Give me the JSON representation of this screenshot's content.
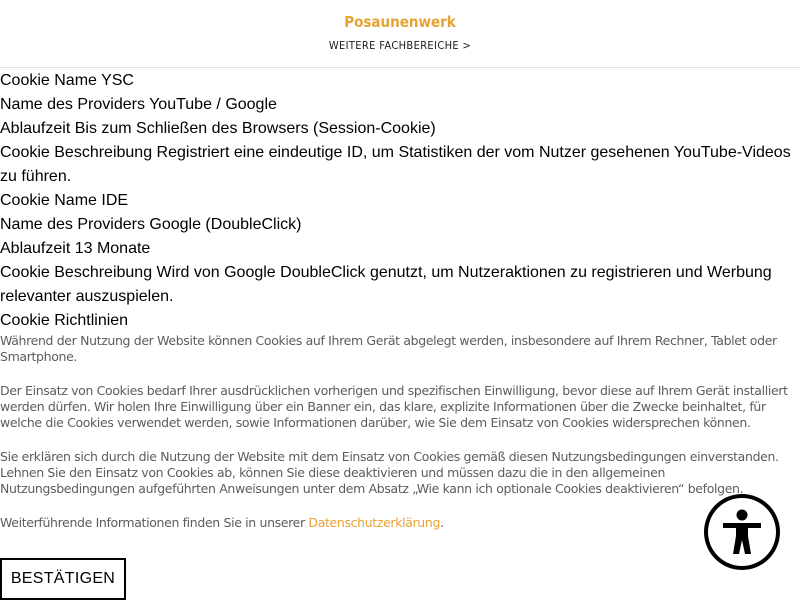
{
  "header": {
    "brand": "Posaunenwerk",
    "subnav_label": "WEITERE FACHBEREICHE >"
  },
  "cookie": {
    "rows": [
      "Cookie Name YSC",
      "Name des Providers YouTube / Google",
      "Ablaufzeit Bis zum Schließen des Browsers (Session-Cookie)",
      "Cookie Beschreibung Registriert eine eindeutige ID, um Statistiken der vom Nutzer gesehenen YouTube-Videos zu führen.",
      "Cookie Name IDE",
      "Name des Providers Google (DoubleClick)",
      "Ablaufzeit 13 Monate",
      "Cookie Beschreibung Wird von Google DoubleClick genutzt, um Nutzeraktionen zu registrieren und Werbung relevanter auszuspielen.",
      "Cookie Richtlinien"
    ]
  },
  "policy": {
    "p1": "Während der Nutzung der Website können Cookies auf Ihrem Gerät abgelegt werden, insbesondere auf Ihrem Rechner, Tablet oder Smartphone.",
    "p2": "Der Einsatz von Cookies bedarf Ihrer ausdrücklichen vorherigen und spezifischen Einwilligung, bevor diese auf Ihrem Gerät installiert werden dürfen. Wir holen Ihre Einwilligung über ein Banner ein, das klare, explizite Informationen über die Zwecke beinhaltet, für welche die Cookies verwendet werden, sowie Informationen darüber, wie Sie dem Einsatz von Cookies widersprechen können.",
    "p3": "Sie erklären sich durch die Nutzung der Website mit dem Einsatz von Cookies gemäß diesen Nutzungsbedingungen einverstanden. Lehnen Sie den Einsatz von Cookies ab, können Sie diese deaktivieren und müssen dazu die in den allgemeinen Nutzungsbedingungen aufgeführten Anweisungen unter dem Absatz „Wie kann ich optionale Cookies deaktivieren“ befolgen.",
    "p4_prefix": "Weiterführende Informationen finden Sie in unserer ",
    "p4_link": "Datenschutzerklärung",
    "p4_suffix": "."
  },
  "confirm_button": "BESTÄTIGEN",
  "accessibility": {
    "icon": "accessibility-person-icon"
  },
  "colors": {
    "accent": "#e7a234",
    "text": "#000000",
    "muted": "#5c5c5c",
    "divider": "#e2e2e2"
  }
}
